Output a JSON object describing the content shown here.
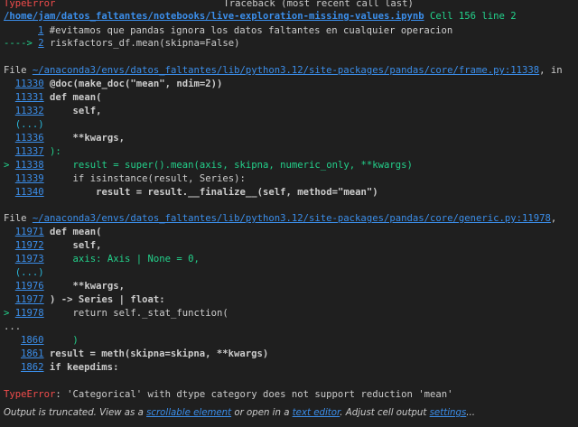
{
  "header": {
    "error_type": "TypeError",
    "traceback_title": "Traceback (most recent call last)",
    "notebook_path": "/home/jam/datos_faltantes/notebooks/live-exploration-missing-values.ipynb",
    "cell_ref": "Cell 156",
    "line_ref": "line 2"
  },
  "cell": [
    {
      "marker": "",
      "num": "1",
      "code": "#evitamos que pandas ignora los datos faltantes en cualquier operacion"
    },
    {
      "marker": "----> ",
      "num": "2",
      "code": "riskfactors_df.mean(skipna=False)"
    }
  ],
  "frame1": {
    "prefix": "File ",
    "path": "~/anaconda3/envs/datos_faltantes/lib/python3.12/site-packages/pandas/core/frame.py:11338",
    "suffix": ", in",
    "lines": [
      {
        "num": "11330",
        "marker": "  ",
        "code": "@doc(make_doc(\"mean\", ndim=2))"
      },
      {
        "num": "11331",
        "marker": "  ",
        "code": "def mean("
      },
      {
        "num": "11332",
        "marker": "  ",
        "code": "    self,"
      },
      {
        "num": "(...)",
        "marker": "  ",
        "code": ""
      },
      {
        "num": "11336",
        "marker": "  ",
        "code": "    **kwargs,"
      },
      {
        "num": "11337",
        "marker": "  ",
        "code": "):"
      },
      {
        "num": "11338",
        "marker": "> ",
        "code": "    result = super().mean(axis, skipna, numeric_only, **kwargs)"
      },
      {
        "num": "11339",
        "marker": "  ",
        "code": "    if isinstance(result, Series):"
      },
      {
        "num": "11340",
        "marker": "  ",
        "code": "        result = result.__finalize__(self, method=\"mean\")"
      }
    ]
  },
  "frame2": {
    "prefix": "File ",
    "path": "~/anaconda3/envs/datos_faltantes/lib/python3.12/site-packages/pandas/core/generic.py:11978",
    "suffix": ",",
    "lines": [
      {
        "num": "11971",
        "marker": "  ",
        "code": "def mean("
      },
      {
        "num": "11972",
        "marker": "  ",
        "code": "    self,"
      },
      {
        "num": "11973",
        "marker": "  ",
        "code": "    axis: Axis | None = 0,"
      },
      {
        "num": "(...)",
        "marker": "  ",
        "code": ""
      },
      {
        "num": "11976",
        "marker": "  ",
        "code": "    **kwargs,"
      },
      {
        "num": "11977",
        "marker": "  ",
        "code": ") -> Series | float:"
      },
      {
        "num": "11978",
        "marker": "> ",
        "code": "    return self._stat_function("
      }
    ]
  },
  "frame3": {
    "ellipsis": "...",
    "lines": [
      {
        "num": "1860",
        "code": "    )"
      },
      {
        "num": "1861",
        "code": "result = meth(skipna=skipna, **kwargs)"
      },
      {
        "num": "1862",
        "code": "if keepdims:"
      }
    ]
  },
  "error": {
    "type": "TypeError",
    "message": ": 'Categorical' with dtype category does not support reduction 'mean'"
  },
  "footer": {
    "t1": "Output is truncated. View as a ",
    "link1": "scrollable element",
    "t2": " or open in a ",
    "link2": "text editor",
    "t3": ". Adjust cell output ",
    "link3": "settings",
    "t4": "..."
  },
  "colors": {
    "background": "#1f1f1f",
    "error": "#f14c4c",
    "arrow": "#23d18b",
    "link": "#3b8eea"
  }
}
